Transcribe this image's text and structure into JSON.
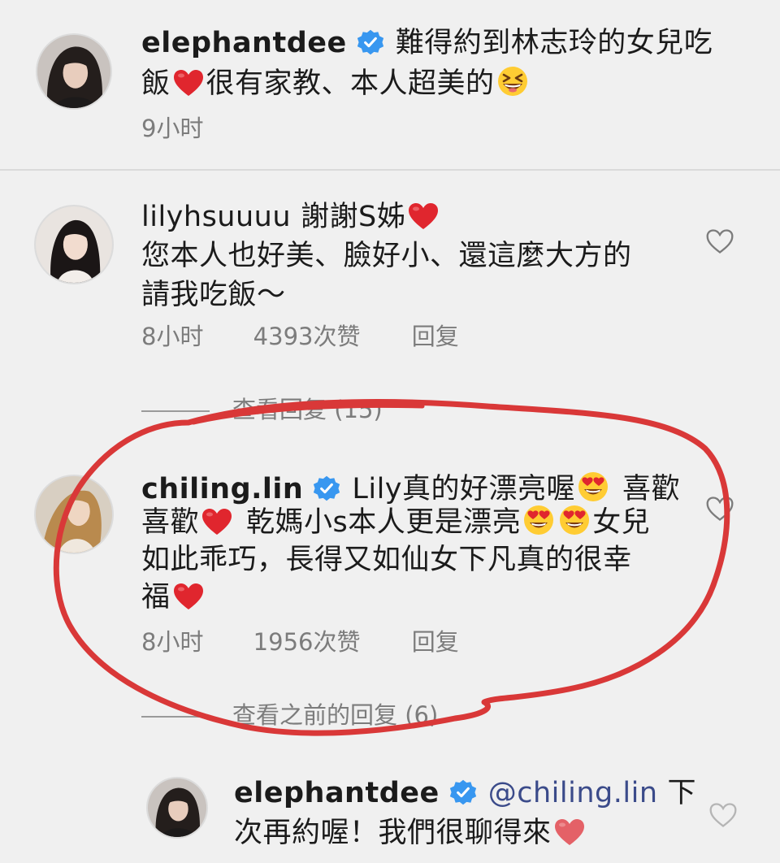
{
  "comments": [
    {
      "username": "elephantdee",
      "line1": "難得約到林志玲的女兒吃",
      "line2a": "飯",
      "line2b": "很有家教、本人超美的",
      "time": "9小时"
    },
    {
      "username": "lilyhsuuuu",
      "line1": "謝謝S姊",
      "line2": "您本人也好美、臉好小、還這麼大方的",
      "line3": "請我吃飯～",
      "time": "8小时",
      "likes": "4393次赞",
      "reply": "回复",
      "view_replies": "查看回复 (15)"
    },
    {
      "username": "chiling.lin",
      "line1a": "Lily真的好漂亮喔",
      "line1b": "喜歡",
      "line2a": "喜歡",
      "line2b": "乾媽小s本人更是漂亮",
      "line2c": "女兒",
      "line3": "如此乖巧，長得又如仙女下凡真的很幸",
      "line4": "福",
      "time": "8小时",
      "likes": "1956次赞",
      "reply": "回复",
      "view_replies": "查看之前的回复 (6)"
    },
    {
      "username": "elephantdee",
      "mention": "@chiling.lin",
      "line1b": "下",
      "line2": "次再約喔！我們很聊得來"
    }
  ],
  "colors": {
    "background": "#f0f0f0",
    "verified": "#3897f0",
    "heart": "#e0262e",
    "annotation": "#d93838"
  },
  "icons": [
    "verified-badge-icon",
    "heart-emoji",
    "grinning-squinting-emoji",
    "heart-eyes-emoji",
    "heart-outline-icon"
  ]
}
